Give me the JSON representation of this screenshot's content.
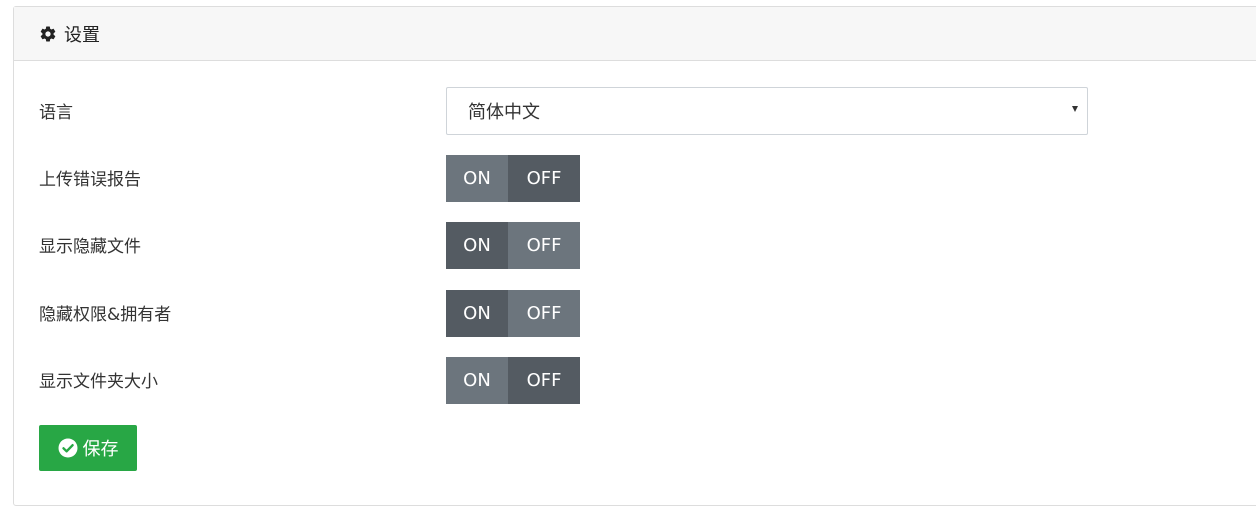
{
  "panel": {
    "title": "设置",
    "icon": "gear-icon"
  },
  "settings": {
    "language": {
      "label": "语言",
      "value": "简体中文"
    },
    "toggles": [
      {
        "label": "上传错误报告",
        "on": "ON",
        "off": "OFF",
        "state": "OFF"
      },
      {
        "label": "显示隐藏文件",
        "on": "ON",
        "off": "OFF",
        "state": "ON"
      },
      {
        "label": "隐藏权限&拥有者",
        "on": "ON",
        "off": "OFF",
        "state": "ON"
      },
      {
        "label": "显示文件夹大小",
        "on": "ON",
        "off": "OFF",
        "state": "OFF"
      }
    ]
  },
  "save_button": {
    "label": "保存",
    "icon": "check-circle-icon"
  },
  "colors": {
    "save": "#28a745",
    "toggle": "#6c757d",
    "toggle_active": "#545b62"
  }
}
